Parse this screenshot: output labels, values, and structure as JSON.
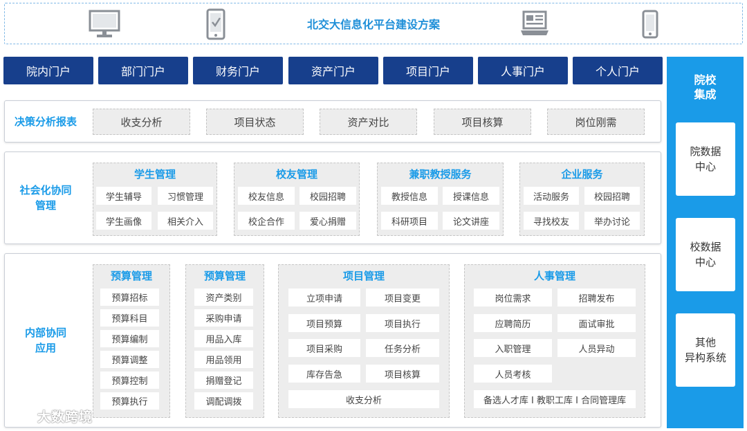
{
  "header": {
    "title": "北交大信息化平台建设方案"
  },
  "portals": [
    "院内门户",
    "部门门户",
    "财务门户",
    "资产门户",
    "项目门户",
    "人事门户",
    "个人门户"
  ],
  "right_column": {
    "title_line1": "院校",
    "title_line2": "集成",
    "boxes": [
      {
        "line1": "院数据",
        "line2": "中心"
      },
      {
        "line1": "校数据",
        "line2": "中心"
      },
      {
        "line1": "其他",
        "line2": "异构系统"
      }
    ]
  },
  "decision": {
    "label": "决策分析报表",
    "items": [
      "收支分析",
      "项目状态",
      "资产对比",
      "项目核算",
      "岗位刚需"
    ]
  },
  "social": {
    "label_line1": "社会化协同",
    "label_line2": "管理",
    "groups": [
      {
        "title": "学生管理",
        "items": [
          "学生辅导",
          "习惯管理",
          "学生画像",
          "相关介入"
        ]
      },
      {
        "title": "校友管理",
        "items": [
          "校友信息",
          "校园招聘",
          "校企合作",
          "爱心捐赠"
        ]
      },
      {
        "title": "兼职教授服务",
        "items": [
          "教授信息",
          "授课信息",
          "科研项目",
          "论文讲座"
        ]
      },
      {
        "title": "企业服务",
        "items": [
          "活动服务",
          "校园招聘",
          "寻找校友",
          "举办讨论"
        ]
      }
    ]
  },
  "internal": {
    "label_line1": "内部协同",
    "label_line2": "应用",
    "budget1": {
      "title": "预算管理",
      "items": [
        "预算招标",
        "预算科目",
        "预算编制",
        "预算调整",
        "预算控制",
        "预算执行"
      ]
    },
    "budget2": {
      "title": "预算管理",
      "items": [
        "资产类别",
        "采购申请",
        "用品入库",
        "用品领用",
        "捐赠登记",
        "调配调拨"
      ]
    },
    "project": {
      "title": "项目管理",
      "items": [
        "立项申请",
        "项目变更",
        "项目预算",
        "项目执行",
        "项目采购",
        "任务分析",
        "库存告急",
        "项目核算"
      ],
      "footer": "收支分析"
    },
    "hr": {
      "title": "人事管理",
      "items": [
        "岗位需求",
        "招聘发布",
        "应聘简历",
        "面试审批",
        "入职管理",
        "人员异动",
        "人员考核"
      ],
      "footer": "备选人才库 I 教职工库 I 合同管理库"
    }
  },
  "watermark": "大数跨境"
}
